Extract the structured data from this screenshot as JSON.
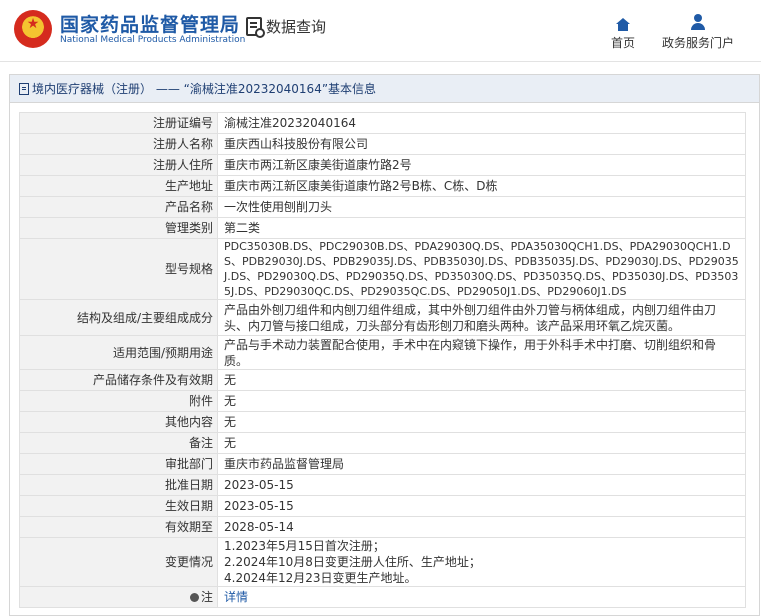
{
  "header": {
    "brand_cn": "国家药品监督管理局",
    "brand_en": "National Medical Products Administration",
    "query_label": "数据查询",
    "nav": [
      {
        "label": "首页",
        "icon": "home-icon"
      },
      {
        "label": "政务服务门户",
        "icon": "user-icon"
      }
    ],
    "brand_color": "#1f5aa6"
  },
  "panel": {
    "title": "境内医疗器械（注册） —— “渝械注准20232040164”基本信息"
  },
  "fields": [
    {
      "key": "注册证编号",
      "value": "渝械注准20232040164"
    },
    {
      "key": "注册人名称",
      "value": "重庆西山科技股份有限公司"
    },
    {
      "key": "注册人住所",
      "value": "重庆市两江新区康美街道康竹路2号"
    },
    {
      "key": "生产地址",
      "value": "重庆市两江新区康美街道康竹路2号B栋、C栋、D栋"
    },
    {
      "key": "产品名称",
      "value": "一次性使用刨削刀头"
    },
    {
      "key": "管理类别",
      "value": "第二类"
    },
    {
      "key": "型号规格",
      "value": "PDC35030B.DS、PDC29030B.DS、PDA29030Q.DS、PDA35030QCH1.DS、PDA29030QCH1.DS、PDB29030J.DS、PDB29035J.DS、PDB35030J.DS、PDB35035J.DS、PD29030J.DS、PD29035J.DS、PD29030Q.DS、PD29035Q.DS、PD35030Q.DS、PD35035Q.DS、PD35030J.DS、PD35035J.DS、PD29030QC.DS、PD29035QC.DS、PD29050J1.DS、PD29060J1.DS"
    },
    {
      "key": "结构及组成/主要组成成分",
      "value": "产品由外刨刀组件和内刨刀组件组成，其中外刨刀组件由外刀管与柄体组成，内刨刀组件由刀头、内刀管与接口组成，刀头部分有齿形刨刀和磨头两种。该产品采用环氧乙烷灭菌。"
    },
    {
      "key": "适用范围/预期用途",
      "value": "产品与手术动力装置配合使用，手术中在内窥镜下操作，用于外科手术中打磨、切削组织和骨质。"
    },
    {
      "key": "产品储存条件及有效期",
      "value": "无"
    },
    {
      "key": "附件",
      "value": "无"
    },
    {
      "key": "其他内容",
      "value": "无"
    },
    {
      "key": "备注",
      "value": "无"
    },
    {
      "key": "审批部门",
      "value": "重庆市药品监督管理局"
    },
    {
      "key": "批准日期",
      "value": "2023-05-15"
    },
    {
      "key": "生效日期",
      "value": "2023-05-15"
    },
    {
      "key": "有效期至",
      "value": "2028-05-14"
    }
  ],
  "changes": {
    "key": "变更情况",
    "lines": [
      "1.2023年5月15日首次注册；",
      "2.2024年10月8日变更注册人住所、生产地址；",
      "4.2024年12月23日变更生产地址。"
    ]
  },
  "note": {
    "key": "注",
    "link": "详情",
    "icon": "info-icon"
  }
}
